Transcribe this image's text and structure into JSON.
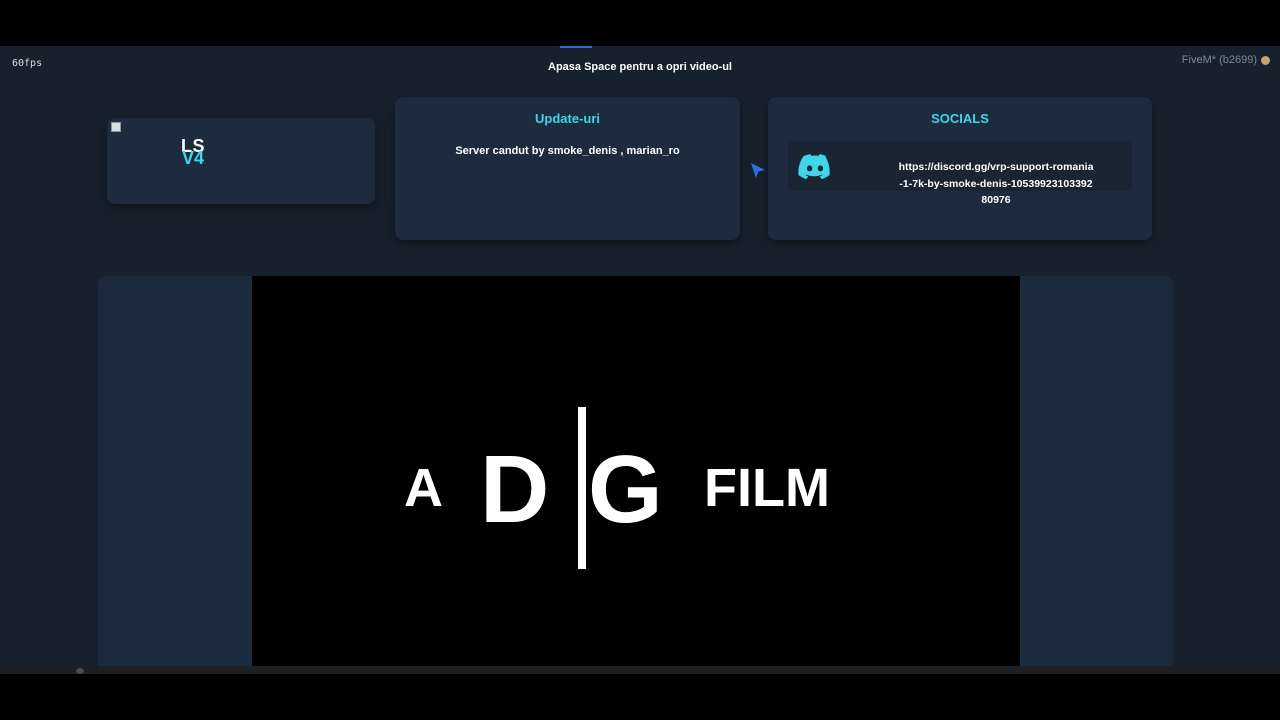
{
  "overlay": {
    "fps": "60fps",
    "hint": "Apasa Space pentru a opri video-ul",
    "client": "FiveM* (b2699)"
  },
  "logo": {
    "line1": "LS",
    "line2": "V4"
  },
  "updates": {
    "title": "Update-uri",
    "text": "Server candut by smoke_denis , marian_ro"
  },
  "socials": {
    "title": "SOCIALS",
    "discord_icon": "discord-icon",
    "discord_link": "https://discord.gg/vrp-support-romania-1-7k-by-smoke-denis-1053992310339280976"
  },
  "video": {
    "title_a": "A",
    "title_d": "D",
    "title_g": "G",
    "title_film": "FILM"
  },
  "colors": {
    "accent": "#3fd5ea",
    "panel": "#1c2b3d",
    "background": "#17212e"
  }
}
